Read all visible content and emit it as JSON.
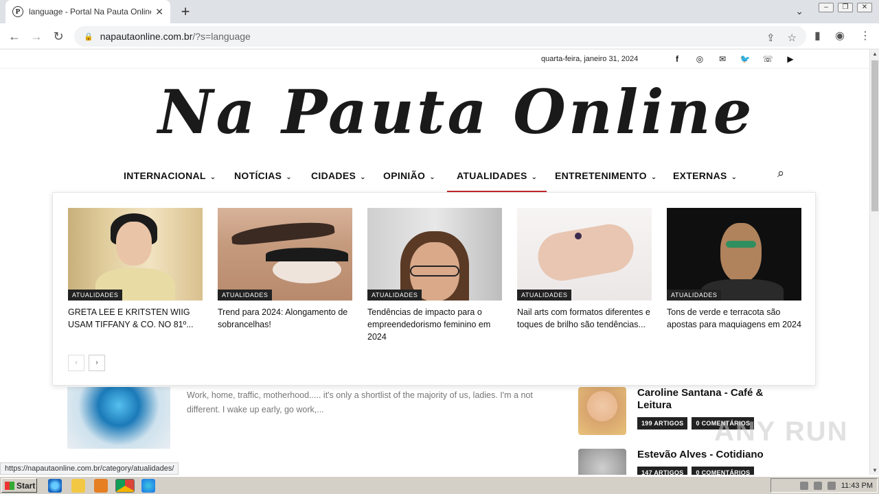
{
  "browser": {
    "tab_title": "language - Portal Na Pauta Online | S",
    "tab_close": "✕",
    "new_tab": "+",
    "url_host": "napautaonline.com.br",
    "url_path": "/?s=language",
    "status_url": "https://napautaonline.com.br/category/atualidades/"
  },
  "topbar": {
    "date": "quarta-feira, janeiro 31, 2024",
    "social": [
      "facebook-icon",
      "instagram-icon",
      "mail-icon",
      "twitter-icon",
      "whatsapp-icon",
      "youtube-icon"
    ]
  },
  "logo": {
    "text": "Na Pauta Online"
  },
  "nav": {
    "items": [
      {
        "label": "INTERNACIONAL"
      },
      {
        "label": "NOTÍCIAS"
      },
      {
        "label": "CIDADES"
      },
      {
        "label": "OPINIÃO"
      },
      {
        "label": "ATUALIDADES"
      },
      {
        "label": "ENTRETENIMENTO"
      },
      {
        "label": "EXTERNAS"
      }
    ],
    "active": "ATUALIDADES",
    "accent": "#c4282c"
  },
  "megamenu": {
    "cards": [
      {
        "category": "ATUALIDADES",
        "title": "GRETA LEE E KRITSTEN WIIG USAM TIFFANY & CO. NO 81º..."
      },
      {
        "category": "ATUALIDADES",
        "title": "Trend para 2024: Alongamento de sobrancelhas!"
      },
      {
        "category": "ATUALIDADES",
        "title": "Tendências de impacto para o empreendedorismo feminino em 2024"
      },
      {
        "category": "ATUALIDADES",
        "title": "Nail arts com formatos diferentes e toques de brilho são tendências..."
      },
      {
        "category": "ATUALIDADES",
        "title": "Tons de verde e terracota são apostas para maquiagens em 2024"
      }
    ],
    "prev": "‹",
    "next": "›"
  },
  "article": {
    "excerpt": "Work, home, traffic, motherhood..... it's only a shortlist of the majority of us, ladies. I'm a not different. I wake up early, go work,..."
  },
  "authors": [
    {
      "name": "Caroline Santana - Café & Leitura",
      "articles": "199 ARTIGOS",
      "comments": "0 COMENTÁRIOS"
    },
    {
      "name": "Estevão Alves - Cotidiano",
      "articles": "147 ARTIGOS",
      "comments": "0 COMENTÁRIOS"
    }
  ],
  "watermark": "ANY RUN",
  "taskbar": {
    "start": "Start",
    "clock": "11:43 PM"
  }
}
